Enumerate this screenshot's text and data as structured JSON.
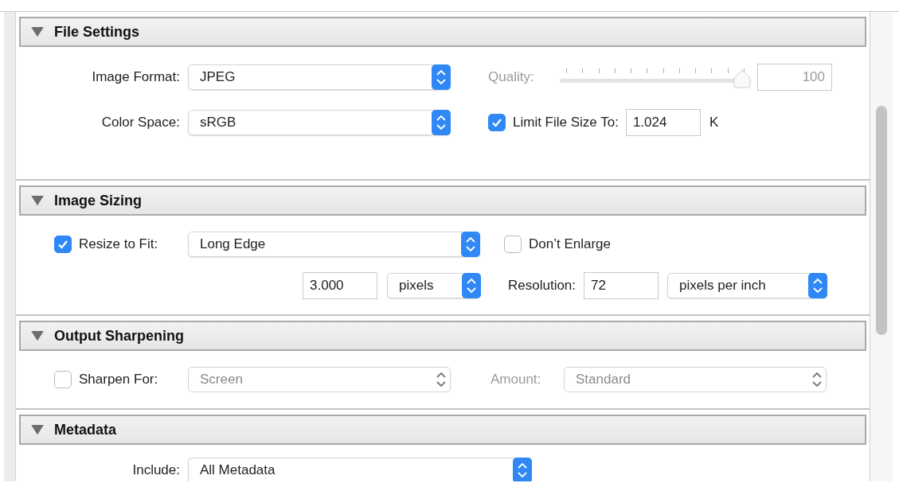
{
  "panel": {
    "sections": [
      {
        "kind": "file",
        "title": "File Settings",
        "expanded": true,
        "image_format": {
          "label": "Image Format:",
          "value": "JPEG",
          "disabled": false
        },
        "color_space": {
          "label": "Color Space:",
          "value": "sRGB",
          "disabled": false
        },
        "quality": {
          "label": "Quality:",
          "level": 1.0,
          "value": "100",
          "disabled": true
        },
        "limit_size": {
          "label": "Limit File Size To:",
          "checked": true,
          "value": "1.024",
          "unit": "K"
        }
      },
      {
        "kind": "sizing",
        "title": "Image Sizing",
        "expanded": true,
        "resize": {
          "label": "Resize to Fit:",
          "checked": true,
          "value": "Long Edge",
          "disabled": false
        },
        "dont_enlarge": {
          "label": "Don’t Enlarge",
          "checked": false
        },
        "size": {
          "value": "3.000",
          "unit": "pixels",
          "disabled": false
        },
        "resolution": {
          "label": "Resolution:",
          "value": "72",
          "unit": "pixels per inch",
          "disabled": false
        }
      },
      {
        "kind": "sharpening",
        "title": "Output Sharpening",
        "expanded": true,
        "sharpen": {
          "label": "Sharpen For:",
          "checked": false,
          "value": "Screen",
          "disabled": true
        },
        "amount": {
          "label": "Amount:",
          "value": "Standard",
          "disabled": true
        }
      },
      {
        "kind": "metadata",
        "title": "Metadata",
        "expanded": true,
        "include": {
          "label": "Include:",
          "value": "All Metadata",
          "disabled": false
        }
      }
    ]
  }
}
